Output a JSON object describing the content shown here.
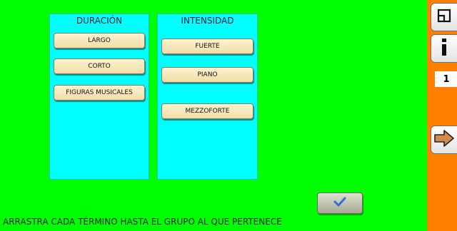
{
  "groups": [
    {
      "title": "DURACIÓN",
      "terms": [
        "LARGO",
        "CORTO",
        "FIGURAS MUSICALES"
      ]
    },
    {
      "title": "INTENSIDAD",
      "terms": [
        "FUERTE",
        "PIANO",
        "MEZZOFORTE"
      ]
    }
  ],
  "sidebar": {
    "page_number": "1",
    "icons": [
      "fullscreen-icon",
      "info-icon",
      "next-arrow-icon"
    ]
  },
  "check": {
    "icon": "checkmark-icon"
  },
  "instruction": "ARRASTRA CADA TÉRMINO HASTA EL GRUPO AL QUE PERTENECE",
  "colors": {
    "background": "#00ff00",
    "group_panel": "#00ffff",
    "sidebar": "#ff8000",
    "term_tile": "#fbecc0",
    "next_arrow": "#d08a4e",
    "checkmark": "#2d6fd6"
  }
}
